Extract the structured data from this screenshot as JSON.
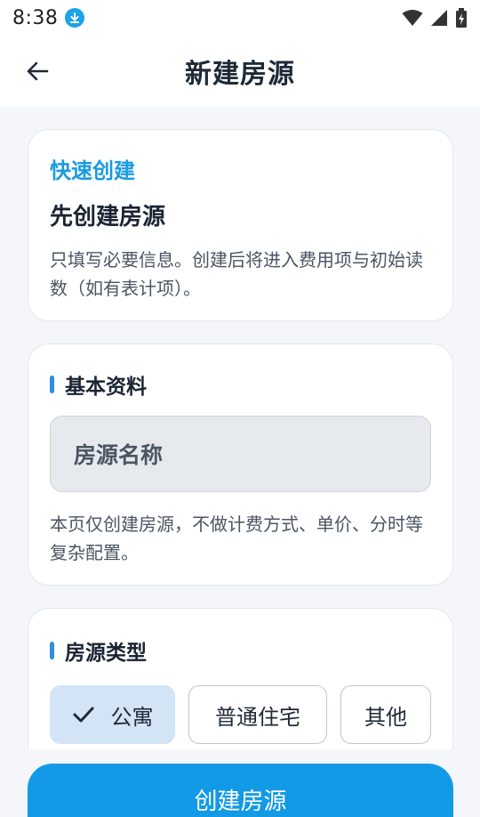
{
  "status_bar": {
    "time": "8:38"
  },
  "app_bar": {
    "title": "新建房源"
  },
  "intro": {
    "tag": "快速创建",
    "title": "先创建房源",
    "description": "只填写必要信息。创建后将进入费用项与初始读数（如有表计项）。"
  },
  "basic": {
    "section_title": "基本资料",
    "name_placeholder": "房源名称",
    "note": "本页仅创建房源，不做计费方式、单价、分时等复杂配置。"
  },
  "type": {
    "section_title": "房源类型",
    "options": [
      {
        "label": "公寓",
        "selected": true
      },
      {
        "label": "普通住宅",
        "selected": false
      },
      {
        "label": "其他",
        "selected": false
      }
    ]
  },
  "actions": {
    "create_label": "创建房源"
  },
  "colors": {
    "accent": "#129ae6",
    "tag": "#1a9be0",
    "selected_chip": "#d3e4f7"
  }
}
